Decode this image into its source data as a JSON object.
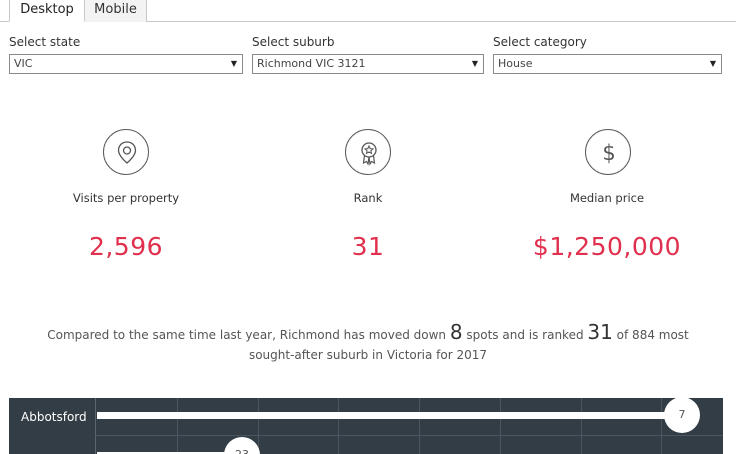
{
  "tabs": [
    {
      "label": "Desktop",
      "active": true
    },
    {
      "label": "Mobile",
      "active": false
    }
  ],
  "filters": {
    "state": {
      "label": "Select state",
      "value": "VIC"
    },
    "suburb": {
      "label": "Select suburb",
      "value": "Richmond VIC 3121"
    },
    "category": {
      "label": "Select category",
      "value": "House"
    }
  },
  "kpis": [
    {
      "icon": "location-pin-icon",
      "label": "Visits per property",
      "value": "2,596"
    },
    {
      "icon": "award-ribbon-icon",
      "label": "Rank",
      "value": "31"
    },
    {
      "icon": "dollar-icon",
      "label": "Median price",
      "value": "$1,250,000"
    }
  ],
  "summary": {
    "part1": "Compared to the same time last year, Richmond has moved down ",
    "moved_spots": "8",
    "part2": " spots and is ranked ",
    "rank": "31",
    "part3": " of 884  most",
    "line2": "sought-after suburb in Victoria for 2017"
  },
  "colors": {
    "accent": "#e0304d",
    "chart_background": "#333d45"
  },
  "chart_data": {
    "type": "bar",
    "categories": [
      "Abbotsford",
      ""
    ],
    "values": [
      7,
      23
    ]
  }
}
